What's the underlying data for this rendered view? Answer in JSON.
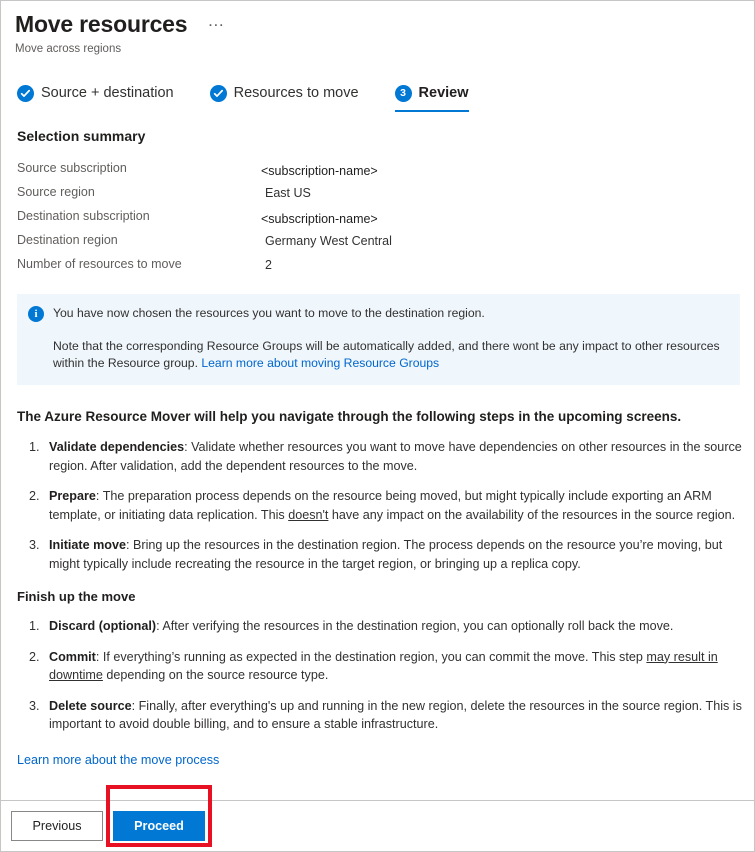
{
  "header": {
    "title": "Move resources",
    "subtitle": "Move across regions",
    "more_menu": "…"
  },
  "tabs": [
    {
      "label": "Source + destination",
      "state": "complete",
      "icon": "check-circle-icon"
    },
    {
      "label": "Resources to move",
      "state": "complete",
      "icon": "check-circle-icon"
    },
    {
      "label": "Review",
      "state": "active",
      "number": "3"
    }
  ],
  "summary": {
    "heading": "Selection summary",
    "rows": [
      {
        "label": "Source subscription",
        "value": "<subscription-name>"
      },
      {
        "label": "Source region",
        "value": "East US"
      },
      {
        "label": "Destination subscription",
        "value": "<subscription-name>"
      },
      {
        "label": "Destination region",
        "value": "Germany West Central"
      },
      {
        "label": "Number of resources to move",
        "value": "2"
      }
    ]
  },
  "info_banner": {
    "icon": "info-icon",
    "line1": "You have now chosen the resources you want to move to the destination region.",
    "line2_prefix": "Note that the corresponding Resource Groups will be automatically added, and there wont be any impact to other resources within the Resource group. ",
    "line2_link": "Learn more about moving Resource Groups"
  },
  "content": {
    "lead": "The Azure Resource Mover will help you navigate through the following steps in the upcoming screens.",
    "steps": [
      {
        "term": "Validate dependencies",
        "text_before": ": Validate whether resources you want to move have dependencies on other resources in the source region. After validation, add the dependent resources to the move.",
        "underline": "",
        "text_after": ""
      },
      {
        "term": "Prepare",
        "text_before": ": The preparation process depends on the resource being moved, but might typically include exporting an ARM template, or initiating data replication. This ",
        "underline": "doesn't",
        "text_after": " have any impact on the availability of the resources in the source region."
      },
      {
        "term": "Initiate move",
        "text_before": ": Bring up the resources in the destination region. The process depends on the resource you’re moving, but might typically include recreating the resource in the target region, or bringing up a replica copy.",
        "underline": "",
        "text_after": ""
      }
    ],
    "finish_heading": "Finish up the move",
    "finish_steps": [
      {
        "term": "Discard (optional)",
        "text_before": ": After verifying the resources in the destination region, you can optionally roll back the move.",
        "underline": "",
        "text_after": ""
      },
      {
        "term": "Commit",
        "text_before": ": If everything’s running as expected in the destination region, you can commit the move. This step ",
        "underline": "may result in downtime",
        "text_after": " depending on the source resource type."
      },
      {
        "term": "Delete source",
        "text_before": ": Finally, after everything's up and running in the new region, delete the resources in the source region. This is important to avoid double billing, and to ensure a stable infrastructure.",
        "underline": "",
        "text_after": ""
      }
    ],
    "bottom_link": "Learn more about the move process"
  },
  "footer": {
    "previous_label": "Previous",
    "proceed_label": "Proceed"
  },
  "colors": {
    "accent": "#0078d4",
    "link": "#0066cc",
    "banner_bg": "#eff6fc",
    "annotation": "#e81123",
    "text": "#323130",
    "muted": "#605e5c"
  }
}
